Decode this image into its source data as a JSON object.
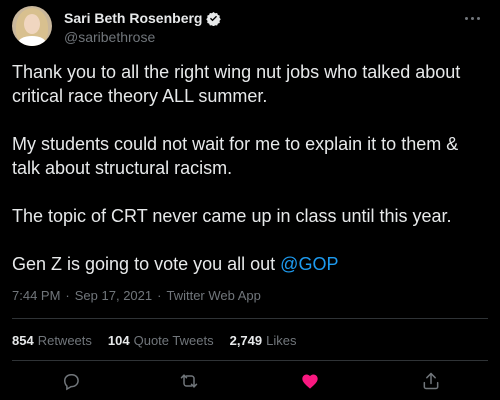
{
  "author": {
    "display_name": "Sari Beth Rosenberg",
    "handle": "@saribethrose",
    "verified_icon": "verified-badge-icon"
  },
  "tweet": {
    "paragraphs": [
      "Thank you to all the right wing nut jobs who talked about critical race theory ALL summer.",
      "My students could not wait for me to explain it to them & talk about structural racism.",
      "The topic of CRT never came up in class until this year."
    ],
    "last_paragraph_text": "Gen Z is going to vote you all out",
    "mention": "@GOP"
  },
  "meta": {
    "time": "7:44 PM",
    "date": "Sep 17, 2021",
    "client": "Twitter Web App",
    "separator": "·"
  },
  "stats": {
    "retweets_count": "854",
    "retweets_label": "Retweets",
    "quote_count": "104",
    "quote_label": "Quote Tweets",
    "likes_count": "2,749",
    "likes_label": "Likes"
  },
  "actions": {
    "reply_icon": "reply-icon",
    "retweet_icon": "retweet-icon",
    "like_icon": "heart-icon",
    "share_icon": "share-icon"
  },
  "colors": {
    "background": "#000000",
    "text": "#e7e9ea",
    "secondary_text": "#71767b",
    "link": "#1d9bf0",
    "like_active": "#f91880",
    "verified": "#1d9bf0"
  }
}
